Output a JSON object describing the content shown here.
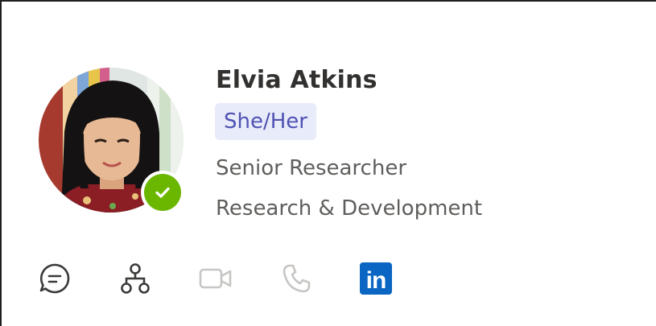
{
  "contact": {
    "name": "Elvia Atkins",
    "pronouns": "She/Her",
    "job_title": "Senior Researcher",
    "department": "Research & Development",
    "presence": "available"
  },
  "actions": [
    {
      "icon": "chat-icon",
      "enabled": true
    },
    {
      "icon": "org-chart-icon",
      "enabled": true
    },
    {
      "icon": "video-call-icon",
      "enabled": false
    },
    {
      "icon": "phone-icon",
      "enabled": false
    },
    {
      "icon": "linkedin-icon",
      "enabled": true,
      "text": "in"
    }
  ],
  "colors": {
    "presence_available": "#6bb700",
    "pronoun_bg": "#e8ebfa",
    "pronoun_text": "#4f52b2",
    "icon_enabled": "#3b3a39",
    "icon_disabled": "#c8c6c4",
    "linkedin": "#0a66c2"
  }
}
